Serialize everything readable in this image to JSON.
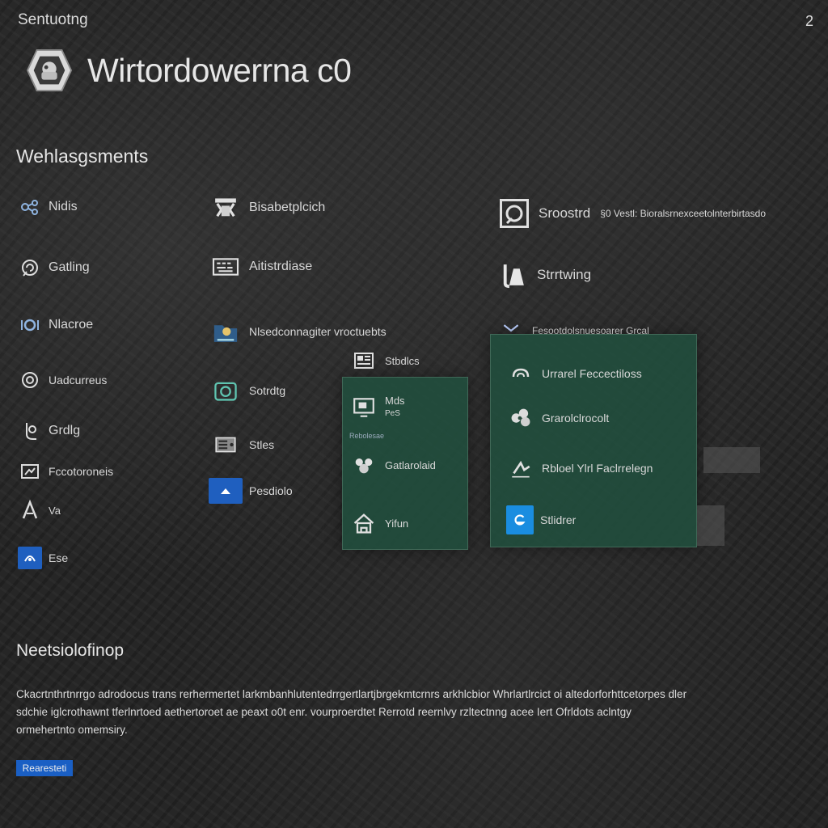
{
  "window": {
    "title": "Sentuotng",
    "control": "2"
  },
  "app": {
    "title": "Wirtordowerrna c0"
  },
  "section": {
    "heading": "Wehlasgsments"
  },
  "col1": [
    {
      "label": "Nidis",
      "icon": "network-icon"
    },
    {
      "label": "Gatling",
      "icon": "refresh-icon"
    },
    {
      "label": "Nlacroe",
      "icon": "settings-icon"
    },
    {
      "label": "Uadcurreus",
      "icon": "sync-icon"
    },
    {
      "label": "Grdlg",
      "icon": "user-icon"
    },
    {
      "label": "Fccotoroneis",
      "icon": "window-icon"
    },
    {
      "label": "Va",
      "icon": "triangle-icon"
    },
    {
      "label": "Ese",
      "icon": "blue-app-icon"
    }
  ],
  "col2": [
    {
      "label": "Bisabetplcich",
      "icon": "bug-icon"
    },
    {
      "label": "Aitistrdiase",
      "icon": "keyboard-icon"
    },
    {
      "label": "Nlsedconnagiter vroctuebts",
      "icon": "folder-icon"
    },
    {
      "label": "Sotrdtg",
      "icon": "camera-icon"
    },
    {
      "label": "Stles",
      "icon": "drive-icon"
    },
    {
      "label": "Pesdiolo",
      "icon": "blue-app-icon"
    }
  ],
  "col3": [
    {
      "label": "Sroostrd",
      "extra": "§0 Vestl: Bioralsrnexceetolnterbirtasdo",
      "icon": "photo-icon"
    },
    {
      "label": "Strrtwing",
      "icon": "flask-icon"
    },
    {
      "label": "Fesootdolsnuesoarer Grcal",
      "icon": "tablet-icon"
    },
    {
      "label": "Stbdlcs",
      "icon": "card-icon"
    }
  ],
  "panel_left": [
    {
      "label": "Mds",
      "sub": "PeS",
      "icon": "monitor-icon"
    },
    {
      "label": "Gatlarolaid",
      "icon": "people-icon"
    },
    {
      "label": "Yifun",
      "icon": "home-icon"
    }
  ],
  "panel_left_caption": "Rebolesae",
  "panel_right": [
    {
      "label": "Urrarel Feccectiloss",
      "icon": "cloud-icon"
    },
    {
      "label": "Grarolclrocolt",
      "icon": "network-cloud-icon"
    },
    {
      "label": "Rbloel Ylrl Faclrrelegn",
      "icon": "feather-icon"
    },
    {
      "label": "Stlidrer",
      "icon": "blue-app-icon"
    }
  ],
  "footer": {
    "heading": "Neetsiolofinop",
    "lines": [
      "Ckacrtnthrtnrrgo adrodocus trans rerhermertet larkmbanhlutentedrrgertlartjbrgekmtcrnrs arkhlcbior Whrlartlrcict oi altedorforhttcetorpes dler",
      "sdchie iglcrothawnt tferlnrtoed aethertoroet ae peaxt o0t enr. vourproerdtet Rerrotd reernlvy rzltectnng acee Iert Ofrldots aclntgy",
      "ormehertnto omemsiry."
    ],
    "button_label": "Rearesteti"
  },
  "colors": {
    "accent": "#1f5fbf",
    "panel": "#214e3e",
    "bg": "#262626"
  }
}
